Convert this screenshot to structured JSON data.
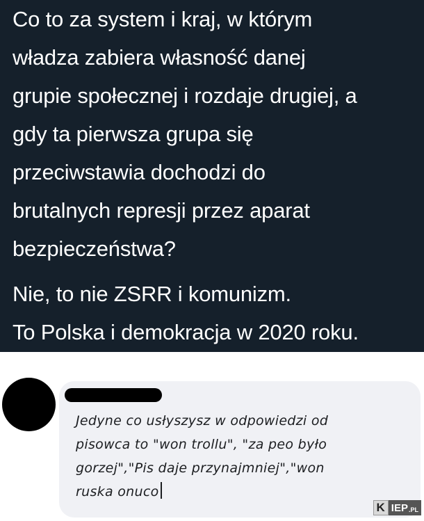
{
  "tweet": {
    "lines": [
      "Co to za system i kraj, w którym",
      "władza zabiera własność danej",
      "grupie społecznej i rozdaje drugiej, a",
      "gdy ta pierwsza grupa się",
      "przeciwstawia dochodzi do",
      "brutalnych represji przez aparat",
      "bezpieczeństwa?",
      "Nie, to nie ZSRR i komunizm.",
      "To Polska i demokracja w 2020 roku."
    ]
  },
  "comment": {
    "lines": [
      "Jedyne co usłyszysz w odpowiedzi od",
      "pisowca to \"won trollu\", \"za peo było",
      "gorzej\",\"Pis daje przynajmniej\",\"won",
      "ruska onuco"
    ]
  },
  "watermark": {
    "k": "K",
    "rest": "IEP",
    "suffix": ".PL"
  },
  "colors": {
    "tweet_bg": "#15202b",
    "bubble_bg": "#f0f1f5"
  }
}
